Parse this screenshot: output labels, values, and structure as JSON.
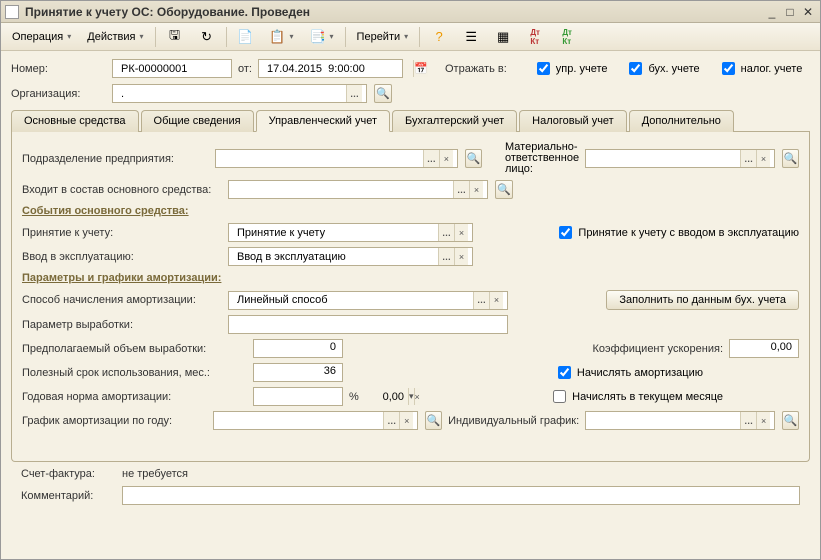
{
  "title": "Принятие к учету ОС: Оборудование. Проведен",
  "toolbar": {
    "operation": "Операция",
    "actions": "Действия",
    "goto": "Перейти"
  },
  "header": {
    "number_label": "Номер:",
    "number": "РК-00000001",
    "from_label": "от:",
    "date": "17.04.2015  9:00:00",
    "reflect_label": "Отражать в:",
    "chk_upr": "упр. учете",
    "chk_buh": "бух. учете",
    "chk_nal": "налог. учете",
    "org_label": "Организация:",
    "org": "."
  },
  "tabs": [
    "Основные средства",
    "Общие сведения",
    "Управленческий учет",
    "Бухгалтерский учет",
    "Налоговый учет",
    "Дополнительно"
  ],
  "mgmt": {
    "division_label": "Подразделение предприятия:",
    "division": "",
    "part_of_label": "Входит в состав основного средства:",
    "part_of": "",
    "mol_label1": "Материально-",
    "mol_label2": "ответственное",
    "mol_label3": "лицо:",
    "mol": "",
    "events_title": "События основного средства:",
    "accept_label": "Принятие к учету:",
    "accept": "Принятие к учету",
    "commission_label": "Ввод в эксплуатацию:",
    "commission": "Ввод в эксплуатацию",
    "commission_chk": "Принятие к учету с вводом в эксплуатацию",
    "amort_title": "Параметры и графики амортизации:",
    "method_label": "Способ начисления амортизации:",
    "method": "Линейный способ",
    "fill_btn": "Заполнить по данным бух. учета",
    "param_label": "Параметр выработки:",
    "param": "",
    "volume_label": "Предполагаемый объем выработки:",
    "volume": "0",
    "coef_label": "Коэффициент ускорения:",
    "coef": "0,00",
    "life_label": "Полезный срок использования, мес.:",
    "life": "36",
    "calc_amort_chk": "Начислять амортизацию",
    "rate_label": "Годовая норма амортизации:",
    "rate": "0,00",
    "rate_pct": "%",
    "current_month_chk": "Начислять в текущем месяце",
    "year_sched_label": "График амортизации по году:",
    "year_sched": "",
    "indiv_sched_label": "Индивидуальный график:",
    "indiv_sched": ""
  },
  "footer": {
    "invoice_label": "Счет-фактура:",
    "invoice": "не требуется",
    "comment_label": "Комментарий:",
    "comment": ""
  }
}
